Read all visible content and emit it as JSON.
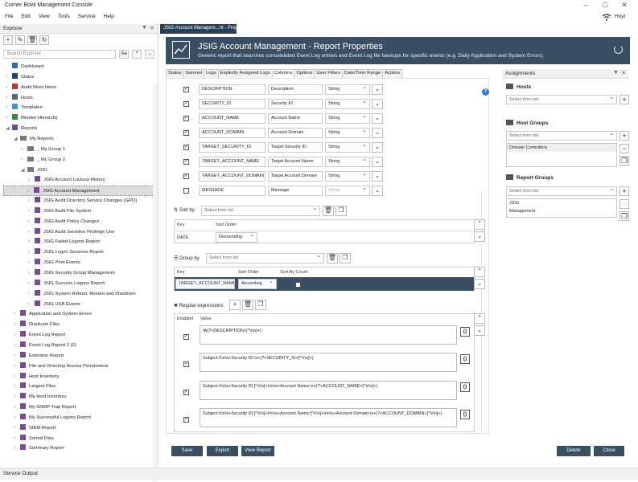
{
  "window": {
    "title": "Corner Bowl Management Console",
    "user": "Hoyt"
  },
  "menu": [
    "File",
    "Edit",
    "View",
    "Tools",
    "Service",
    "Help"
  ],
  "explorer": {
    "title": "Explorer",
    "search_placeholder": "Search Explorer",
    "case_btn": "Aa",
    "tree": [
      {
        "label": "Dashboard",
        "d": 1,
        "icon": "dashboard"
      },
      {
        "label": "Status",
        "d": 1,
        "icon": "status"
      },
      {
        "label": "Audit Work Items",
        "d": 1,
        "icon": "audit"
      },
      {
        "label": "Hosts",
        "d": 1,
        "icon": "hosts"
      },
      {
        "label": "Templates",
        "d": 1,
        "icon": "templates"
      },
      {
        "label": "Monitor Hierarchy",
        "d": 1,
        "icon": "monitor"
      },
      {
        "label": "Reports",
        "d": 1,
        "icon": "reports"
      },
      {
        "label": "My Reports",
        "d": 2,
        "icon": "folder"
      },
      {
        "label": "_ My Group 1",
        "d": 3,
        "icon": "folder"
      },
      {
        "label": "_ My Group 2",
        "d": 3,
        "icon": "folder"
      },
      {
        "label": "JSIG",
        "d": 3,
        "icon": "folder"
      },
      {
        "label": "JSIG Account Lockout History",
        "d": 4,
        "icon": "report"
      },
      {
        "label": "JSIG Account Management",
        "d": 4,
        "icon": "report",
        "sel": true
      },
      {
        "label": "JSIG Audit Directory Service Changes (GPO)",
        "d": 4,
        "icon": "report"
      },
      {
        "label": "JSIG Audit File System",
        "d": 4,
        "icon": "report"
      },
      {
        "label": "JSIG Audit Policy Changes",
        "d": 4,
        "icon": "report"
      },
      {
        "label": "JSIG Audit Sensitive Privilege Use",
        "d": 4,
        "icon": "report"
      },
      {
        "label": "JSIG Failed Logons Report",
        "d": 4,
        "icon": "report"
      },
      {
        "label": "JSIG Logon Sessions Report",
        "d": 4,
        "icon": "report"
      },
      {
        "label": "JSIG Print Events",
        "d": 4,
        "icon": "report"
      },
      {
        "label": "JSIG Security Group Management",
        "d": 4,
        "icon": "report"
      },
      {
        "label": "JSIG Success Logons Report",
        "d": 4,
        "icon": "report"
      },
      {
        "label": "JSIG System Reboot, Restart and Shutdown",
        "d": 4,
        "icon": "report"
      },
      {
        "label": "JSIG USB Events",
        "d": 4,
        "icon": "report"
      },
      {
        "label": "Application and System Errors",
        "d": 2,
        "icon": "report"
      },
      {
        "label": "Duplicate Files",
        "d": 2,
        "icon": "report"
      },
      {
        "label": "Event Log Report",
        "d": 2,
        "icon": "report"
      },
      {
        "label": "Event Log Report 2 (2)",
        "d": 2,
        "icon": "report"
      },
      {
        "label": "Extention Report",
        "d": 2,
        "icon": "report"
      },
      {
        "label": "File and Directory Access Permissions",
        "d": 2,
        "icon": "report"
      },
      {
        "label": "Host Inventory",
        "d": 2,
        "icon": "report"
      },
      {
        "label": "Largest Files",
        "d": 2,
        "icon": "report"
      },
      {
        "label": "My Host Inventory",
        "d": 2,
        "icon": "report"
      },
      {
        "label": "My SNMP Trap Report",
        "d": 2,
        "icon": "report"
      },
      {
        "label": "My Successful Logons Report",
        "d": 2,
        "icon": "report"
      },
      {
        "label": "SIEM Report",
        "d": 2,
        "icon": "report"
      },
      {
        "label": "Sorted Files",
        "d": 2,
        "icon": "report"
      },
      {
        "label": "Summary Report",
        "d": 2,
        "icon": "report"
      }
    ]
  },
  "doc_tab": "JSIG Account Managem...nt - Properties",
  "header": {
    "title": "JSIG Account Management - Report Properties",
    "desc": "Generic report that searches consolidated Event Log entries and Event Log file backups for specific events (e.g. Daily Application and System Errors)."
  },
  "tabs": [
    "Status",
    "General",
    "Logs",
    "Explicitly Assigned Logs",
    "Columns",
    "Options",
    "User Filters",
    "Date/Time Range",
    "Actions"
  ],
  "active_tab": "Columns",
  "columns": [
    {
      "checked": true,
      "key": "DESCRIPTION",
      "name": "Description",
      "type": "String"
    },
    {
      "checked": true,
      "key": "SECURITY_ID",
      "name": "Security ID",
      "type": "String"
    },
    {
      "checked": true,
      "key": "ACCOUNT_NAME",
      "name": "Account Name",
      "type": "String"
    },
    {
      "checked": true,
      "key": "ACCOUNT_DOMAIN",
      "name": "Account Domain",
      "type": "String"
    },
    {
      "checked": true,
      "key": "TARGET_SECURITY_ID",
      "name": "Target Security ID",
      "type": "String"
    },
    {
      "checked": true,
      "key": "TARGET_ACCOUNT_NAME",
      "name": "Target Account Name",
      "type": "String"
    },
    {
      "checked": true,
      "key": "TARGET_ACCOUNT_DOMAIN",
      "name": "Target Account Domain",
      "type": "String"
    },
    {
      "checked": false,
      "key": "MESSAGE",
      "name": "Message",
      "type": "String"
    }
  ],
  "sort": {
    "label": "Sort by",
    "placeholder": "Select from list",
    "h_key": "Key",
    "h_order": "Sort Order",
    "key": "DATE",
    "order": "Descending"
  },
  "group": {
    "label": "Group by",
    "placeholder": "Select from list",
    "h_key": "Key",
    "h_order": "Sort Order",
    "h_count": "Sort By Count",
    "key": "TARGET_ACCOUNT_NAME",
    "order": "Ascending"
  },
  "regex": {
    "label": "Regular expressions",
    "h_enabled": "Enabled",
    "h_value": "Value",
    "rows": [
      "\\A(?<DESCRIPTION>[^\\r\\n]+)",
      "Subject:\\r\\n\\s+Security ID:\\s+(?<SECURITY_ID>[^\\r\\n]+)",
      "Subject:\\r\\n\\s+Security ID:[^\\r\\n]+\\r\\n\\s+Account Name:\\s+(?<ACCOUNT_NAME>[^\\r\\n]+)",
      "Subject:\\r\\n\\s+Security ID:[^\\r\\n]+\\r\\n\\s+Account Name:[^\\r\\n]+\\r\\n\\s+Account Domain:\\s+(?<ACCOUNT_DOMAIN>[^\\r\\n]+)"
    ]
  },
  "buttons": {
    "save": "Save",
    "export": "Export",
    "view": "View Report",
    "delete": "Delete",
    "close": "Close"
  },
  "assign": {
    "title": "Assignments",
    "hosts": "Hosts",
    "host_groups": "Host Groups",
    "report_groups": "Report Groups",
    "placeholder": "Select from list",
    "host_group_items": [
      "Domain Controllers"
    ],
    "report_group_items": [
      "JSIG",
      "Management"
    ]
  },
  "service_output": "Service Output"
}
